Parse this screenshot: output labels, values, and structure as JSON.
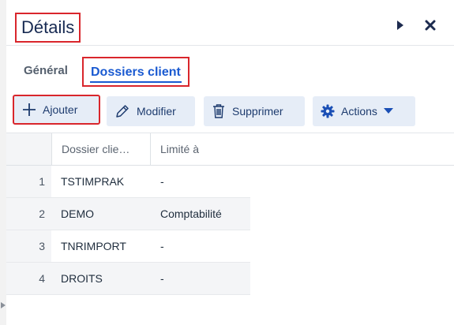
{
  "header": {
    "title": "Détails",
    "icons": [
      "play-right-icon",
      "close-icon"
    ]
  },
  "tabs": [
    {
      "label": "Général",
      "active": false
    },
    {
      "label": "Dossiers client",
      "active": true
    }
  ],
  "toolbar": {
    "add_label": "Ajouter",
    "edit_label": "Modifier",
    "delete_label": "Supprimer",
    "actions_label": "Actions"
  },
  "grid": {
    "columns": [
      "Dossier clie…",
      "Limité à"
    ],
    "rows": [
      {
        "num": "1",
        "dossier": "TSTIMPRAK",
        "limite": "-"
      },
      {
        "num": "2",
        "dossier": "DEMO",
        "limite": "Comptabilité"
      },
      {
        "num": "3",
        "dossier": "TNRIMPORT",
        "limite": "-"
      },
      {
        "num": "4",
        "dossier": "DROITS",
        "limite": "-"
      }
    ]
  },
  "colors": {
    "accent": "#1a5ad1",
    "highlight": "#d9262c",
    "button_bg": "#e6edf7"
  }
}
